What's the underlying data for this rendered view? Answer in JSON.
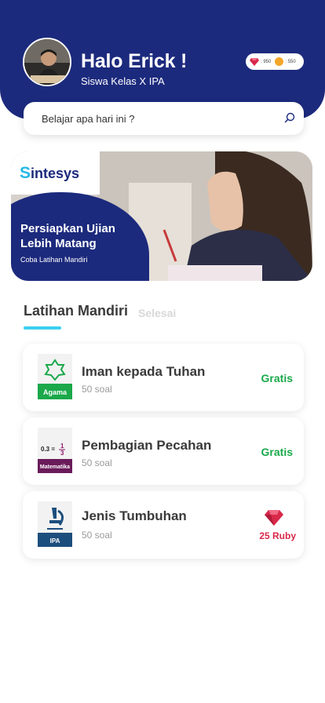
{
  "profile": {
    "greeting": "Halo Erick !",
    "subtitle": "Siswa Kelas X IPA"
  },
  "wallet": {
    "ruby": ": 950",
    "coin": ": 550"
  },
  "search": {
    "placeholder": "Belajar apa hari ini ?"
  },
  "banner": {
    "brand": "intesys",
    "brand_initial": "S",
    "headline": "Persiapkan Ujian Lebih Matang",
    "cta": "Coba Latihan Mandiri"
  },
  "tabs": {
    "active": "Latihan Mandiri",
    "inactive": "Selesai"
  },
  "exercises": [
    {
      "title": "Iman kepada Tuhan",
      "count": "50 soal",
      "subject": "Agama",
      "price": "Gratis"
    },
    {
      "title": "Pembagian Pecahan",
      "count": "50 soal",
      "subject": "Matematika",
      "price": "Gratis",
      "thumb_text": "0.3 =",
      "thumb_num": "1",
      "thumb_den": "3"
    },
    {
      "title": "Jenis Tumbuhan",
      "count": "50 soal",
      "subject": "IPA",
      "price": "25 Ruby"
    }
  ],
  "colors": {
    "primary": "#1c2a7d",
    "accent": "#3ad0ef",
    "free": "#1aa84a",
    "ruby": "#d8284a"
  }
}
